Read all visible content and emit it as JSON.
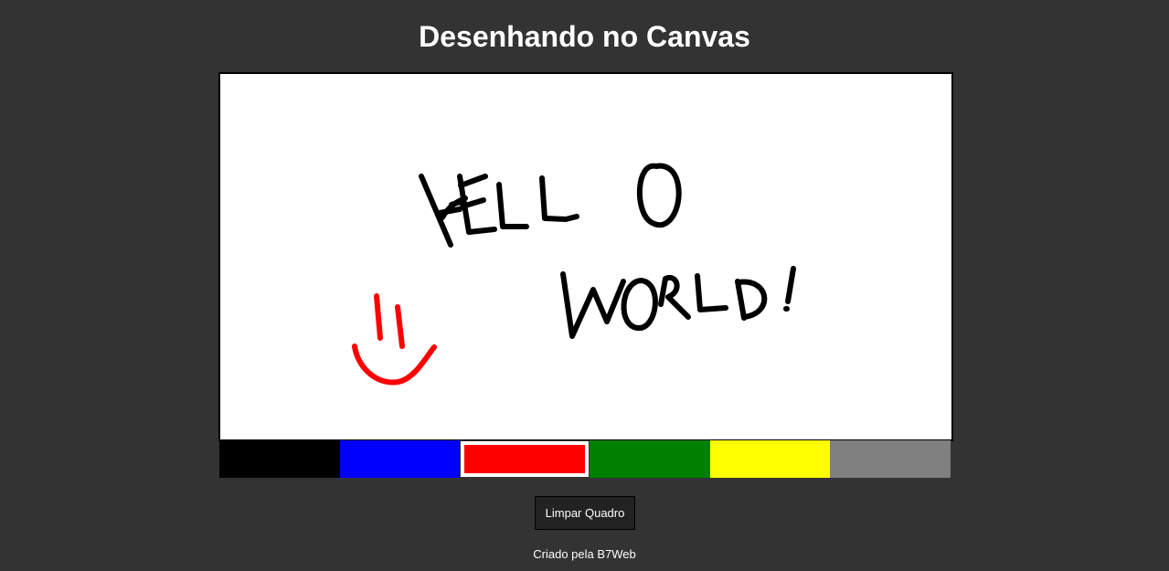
{
  "header": {
    "title": "Desenhando no Canvas"
  },
  "canvas": {
    "background": "#ffffff",
    "strokes": [
      {
        "color": "#000000",
        "text": "HELLO"
      },
      {
        "color": "#000000",
        "text": "WORLD!"
      },
      {
        "color": "#ff0000",
        "text": ""
      }
    ]
  },
  "palette": {
    "selected": "red",
    "colors": [
      {
        "name": "black",
        "hex": "#000000"
      },
      {
        "name": "blue",
        "hex": "#0000ff"
      },
      {
        "name": "red",
        "hex": "#ff0000"
      },
      {
        "name": "green",
        "hex": "#008000"
      },
      {
        "name": "yellow",
        "hex": "#ffff00"
      },
      {
        "name": "gray",
        "hex": "#808080"
      }
    ]
  },
  "controls": {
    "clear_label": "Limpar Quadro"
  },
  "footer": {
    "credit": "Criado pela B7Web"
  }
}
